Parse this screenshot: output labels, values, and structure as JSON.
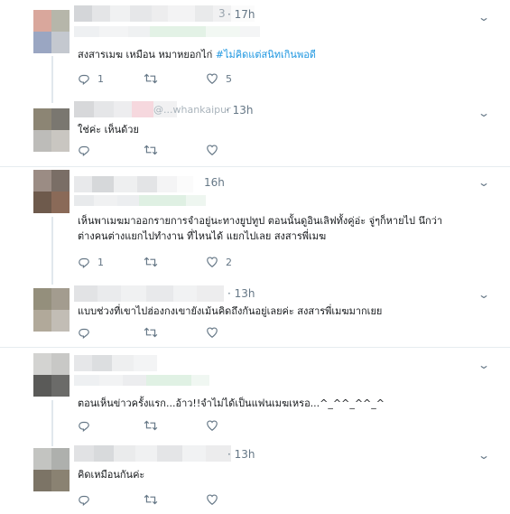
{
  "tweets": [
    {
      "handle_suffix": "3",
      "time": "· 17h",
      "text": "สงสารเมฆ เหมือน หมาหยอกไก่ ",
      "hashtag": "#ไม่คิดแต่สนิทเกินพอดี",
      "reply_count": "1",
      "retweet_count": "",
      "like_count": "5"
    },
    {
      "handle_partial": "@...whankaipur",
      "time": "· 13h",
      "text": "ใช่ค่ะ เห็นด้วย",
      "reply_count": "",
      "retweet_count": "",
      "like_count": ""
    },
    {
      "time": "16h",
      "text_lines": [
        "เห็นพาเมฆมาออกรายการจำอยู่นะทางยูปทูป ตอนนั้นดูอินเลิฟทั้งคู่อ่ะ จู่ๆก็หายไป นึกว่า",
        "ต่างคนต่างแยกไปทำงาน ที่ไหนได้ แยกไปเลย สงสารพี่เมฆ"
      ],
      "reply_count": "1",
      "retweet_count": "",
      "like_count": "2"
    },
    {
      "time": "· 13h",
      "text": "แบบช่วงที่เขาไปฮ่องกงเขายังเม้นคิดถึงกันอยู่เลยค่ะ สงสารพี่เมฆมากเยย",
      "reply_count": "",
      "retweet_count": "",
      "like_count": ""
    },
    {
      "text": "ตอนเห็นข่าวครั้งแรก...อ้าว!!จำไม่ได้เป็นแฟนเมฆเหรอ...^_^^_^^_^",
      "reply_count": "",
      "retweet_count": "",
      "like_count": ""
    },
    {
      "time": "· 13h",
      "text": "คิดเหมือนกันค่ะ",
      "reply_count": "",
      "retweet_count": "",
      "like_count": ""
    }
  ],
  "icons": {
    "reply": "reply-icon",
    "retweet": "retweet-icon",
    "like": "heart-icon",
    "menu": "chevron-down-icon"
  },
  "colors": {
    "hashtag": "#1b95e0",
    "muted": "#657786",
    "separator": "#e6ecf0"
  }
}
